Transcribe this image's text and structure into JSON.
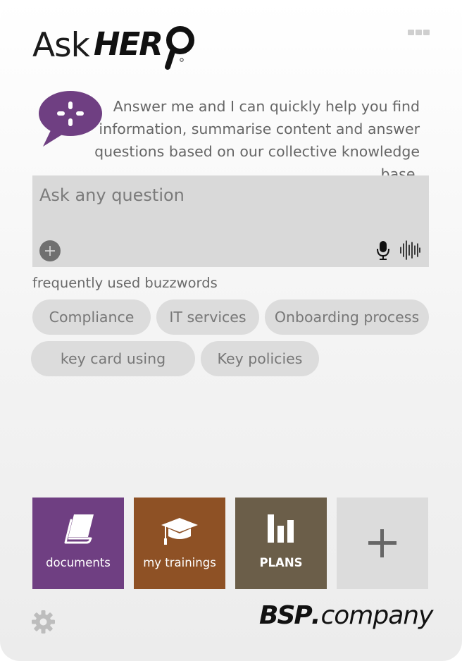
{
  "brand": {
    "ask": "Ask",
    "hero": "HER"
  },
  "intro": {
    "text": "Answer me and I can quickly help you find information, summarise content and answer questions based on our collective knowledge base."
  },
  "search": {
    "placeholder": "Ask any question",
    "value": ""
  },
  "buzzwords": {
    "label": "frequently used buzzwords",
    "chips": [
      {
        "label": "Compliance"
      },
      {
        "label": "IT services"
      },
      {
        "label": "Onboarding process"
      },
      {
        "label": "key card using"
      },
      {
        "label": "Key policies"
      }
    ]
  },
  "tiles": [
    {
      "label": "documents",
      "color": "#6f3f82",
      "icon": "book-icon"
    },
    {
      "label": "my trainings",
      "color": "#8e5125",
      "icon": "graduation-cap-icon"
    },
    {
      "label": "PLANS",
      "color": "#6b5e49",
      "icon": "bar-chart-icon"
    },
    {
      "label": "",
      "color": "#dcdcdc",
      "icon": "plus-icon"
    }
  ],
  "footer": {
    "company_bold": "BSP",
    "company_dot": ".",
    "company_rest": "company"
  },
  "colors": {
    "accent_purple": "#6f3f82",
    "input_bg": "#d9d9d9",
    "chip_bg": "#dcdcdc"
  }
}
